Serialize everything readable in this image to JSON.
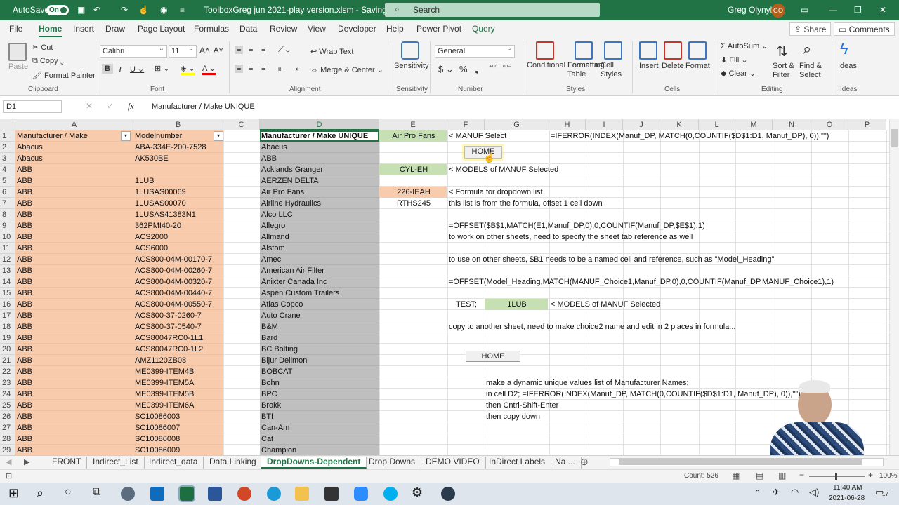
{
  "titlebar": {
    "autosave": "AutoSave",
    "toggle": "On",
    "filename": "ToolboxGreg jun 2021-play version.xlsm  -  Saving...",
    "search": "Search",
    "user": "Greg Olynyk",
    "initials": "GO"
  },
  "menu_tabs": [
    "File",
    "Home",
    "Insert",
    "Draw",
    "Page Layout",
    "Formulas",
    "Data",
    "Review",
    "View",
    "Developer",
    "Help",
    "Power Pivot",
    "Query"
  ],
  "share": "Share",
  "comments": "Comments",
  "ribbon": {
    "clipboard": {
      "paste": "Paste",
      "cut": "Cut",
      "copy": "Copy",
      "format_painter": "Format Painter",
      "group": "Clipboard"
    },
    "font": {
      "name": "Calibri",
      "size": "11",
      "group": "Font"
    },
    "alignment": {
      "wrap": "Wrap Text",
      "merge": "Merge & Center",
      "group": "Alignment"
    },
    "sensitivity": {
      "label": "Sensitivity",
      "group": "Sensitivity"
    },
    "number": {
      "format": "General",
      "group": "Number"
    },
    "styles": {
      "cond": "Conditional Formatting",
      "table": "Format as Table",
      "cell": "Cell Styles",
      "group": "Styles"
    },
    "cells": {
      "insert": "Insert",
      "delete": "Delete",
      "format": "Format",
      "group": "Cells"
    },
    "editing": {
      "autosum": "AutoSum",
      "fill": "Fill",
      "clear": "Clear",
      "sort": "Sort & Filter",
      "find": "Find & Select",
      "group": "Editing"
    },
    "ideas": {
      "label": "Ideas",
      "group": "Ideas"
    }
  },
  "formula_bar": {
    "cell_ref": "D1",
    "fx": "fx",
    "content": "Manufacturer / Make  UNIQUE"
  },
  "columns": [
    "A",
    "B",
    "C",
    "D",
    "E",
    "F",
    "G",
    "H",
    "I",
    "J",
    "K",
    "L",
    "M",
    "N",
    "O",
    "P"
  ],
  "rows": [
    "1",
    "2",
    "3",
    "4",
    "5",
    "6",
    "7",
    "8",
    "9",
    "10",
    "11",
    "12",
    "13",
    "14",
    "15",
    "16",
    "17",
    "18",
    "19",
    "20",
    "21",
    "22",
    "23",
    "24",
    "25",
    "26",
    "27",
    "28",
    "29"
  ],
  "colA": [
    "Manufacturer / Make",
    "Abacus",
    "Abacus",
    "ABB",
    "ABB",
    "ABB",
    "ABB",
    "ABB",
    "ABB",
    "ABB",
    "ABB",
    "ABB",
    "ABB",
    "ABB",
    "ABB",
    "ABB",
    "ABB",
    "ABB",
    "ABB",
    "ABB",
    "ABB",
    "ABB",
    "ABB",
    "ABB",
    "ABB",
    "ABB",
    "ABB",
    "ABB",
    "ABB"
  ],
  "colB": [
    "Modelnumber",
    "ABA-334E-200-7528",
    "AK530BE",
    "",
    "1LUB",
    "1LUSAS00069",
    "1LUSAS00070",
    "1LUSAS41383N1",
    "362PMI40-20",
    "ACS2000",
    "ACS6000",
    "ACS800-04M-00170-7",
    "ACS800-04M-00260-7",
    "ACS800-04M-00320-7",
    "ACS800-04M-00440-7",
    "ACS800-04M-00550-7",
    "ACS800-37-0260-7",
    "ACS800-37-0540-7",
    "ACS80047RC0-1L1",
    "ACS80047RC0-1L2",
    "AMZ1120ZB08",
    "ME0399-ITEM4B",
    "ME0399-ITEM5A",
    "ME0399-ITEM5B",
    "ME0399-ITEM6A",
    "SC10086003",
    "SC10086007",
    "SC10086008",
    "SC10086009"
  ],
  "colD": [
    "Manufacturer / Make  UNIQUE",
    "Abacus",
    "ABB",
    "Acklands Granger",
    "AERZEN DELTA",
    "Air Pro Fans",
    "Airline Hydraulics",
    "Alco LLC",
    "Allegro",
    "Allmand",
    "Alstom",
    "Amec",
    "American Air Filter",
    "Anixter Canada Inc",
    "Aspen Custom Trailers",
    "Atlas Copco",
    "Auto Crane",
    "B&M",
    "Bard",
    "BC Bolting",
    "Bijur Delimon",
    "BOBCAT",
    "Bohn",
    "BPC",
    "Brokk",
    "BTI",
    "Can-Am",
    "Cat",
    "Champion"
  ],
  "cells": {
    "e1": "Air Pro Fans",
    "f1": "<  MANUF Select",
    "h1": "=IFERROR(INDEX(Manuf_DP, MATCH(0,COUNTIF($D$1:D1, Manuf_DP), 0)),\"\")",
    "home1": "HOME",
    "e4": "CYL-EH",
    "f4": "< MODELS of MANUF Selected",
    "e6": "226-IEAH",
    "f6": "<  Formula for dropdown list",
    "e7": "RTHS245",
    "f7": "this list is from the formula, offset 1 cell down",
    "f9": "=OFFSET($B$1,MATCH(E1,Manuf_DP,0),0,COUNTIF(Manuf_DP,$E$1),1)",
    "f10": "to work on other sheets, need to specify the sheet tab reference as well",
    "f12": "to use on other sheets, $B1 needs to be a named cell and reference, such as \"Model_Heading\"",
    "f14": "=OFFSET(Model_Heading,MATCH(MANUF_Choice1,Manuf_DP,0),0,COUNTIF(Manuf_DP,MANUF_Choice1),1)",
    "f16": "TEST;",
    "g16": "1LUB",
    "h16": "< MODELS of MANUF Selected",
    "f18": "copy to another sheet, need to make choice2 name and edit in 2 places in formula...",
    "home2": "HOME",
    "g23": "make a dynamic unique values list of Manufacturer Names;",
    "g24": "in cell D2;  =IFERROR(INDEX(Manuf_DP, MATCH(0,COUNTIF($D$1:D1, Manuf_DP), 0)),\"\")",
    "g25": "then Cntrl-Shift-Enter",
    "g26": "then copy down"
  },
  "sheet_tabs": [
    "FRONT",
    "Indirect_List",
    "Indirect_data",
    "Data Linking",
    "DropDowns-Dependent",
    "Drop Downs",
    "DEMO VIDEO",
    "InDirect Labels",
    "Na ..."
  ],
  "active_sheet": "DropDowns-Dependent",
  "status": {
    "count": "Count: 526",
    "zoom": "100%"
  },
  "taskbar": {
    "time": "11:40 AM",
    "date": "2021-06-28",
    "notif": "17"
  },
  "colors": {
    "excel_green": "#217346",
    "peach": "#f8cbad",
    "gray_col": "#bfbfbf",
    "green_cell": "#c6e0b4"
  }
}
